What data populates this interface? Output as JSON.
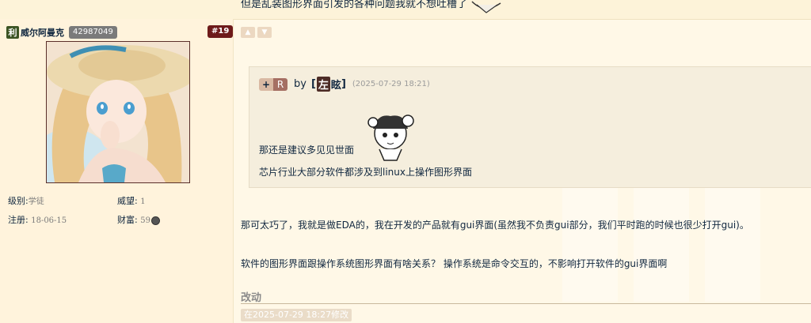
{
  "previous_post": {
    "text_fragment": "但是乱装图形界面引发的各种问题我就不想吐槽了"
  },
  "user": {
    "badge": "利",
    "name": "威尔阿曼克",
    "uid": "42987049",
    "floor": "#19",
    "stats": {
      "level_label": "级别:",
      "level_value": "学徒",
      "prestige_label": "威望:",
      "prestige_value": "1",
      "register_label": "注册:",
      "register_value": "18-06-15",
      "wealth_label": "财富:",
      "wealth_value": "59"
    }
  },
  "quote": {
    "tag_plus": "+",
    "tag_r": "R",
    "by": "by",
    "user_bracket_open": "[",
    "user_first": "左",
    "user_rest": "眩",
    "user_bracket_close": "]",
    "date": "(2025-07-29 18:21)",
    "lines": [
      "那还是建议多见见世面",
      "芯片行业大部分软件都涉及到linux上操作图形界面"
    ]
  },
  "body": {
    "lines": [
      "那可太巧了，我就是做EDA的，我在开发的产品就有gui界面(虽然我不负责gui部分，我们平时跑的时候也很少打开gui)。",
      "软件的图形界面跟操作系统图形界面有啥关系？ 操作系统是命令交互的，不影响打开软件的gui界面啊"
    ]
  },
  "edit": {
    "title": "改动",
    "note": "在2025-07-29 18:27修改"
  },
  "colors": {
    "background": "#fff8e7",
    "floor_badge": "#6e1a1a",
    "user_badge": "#3b5323",
    "text": "#10273f"
  }
}
